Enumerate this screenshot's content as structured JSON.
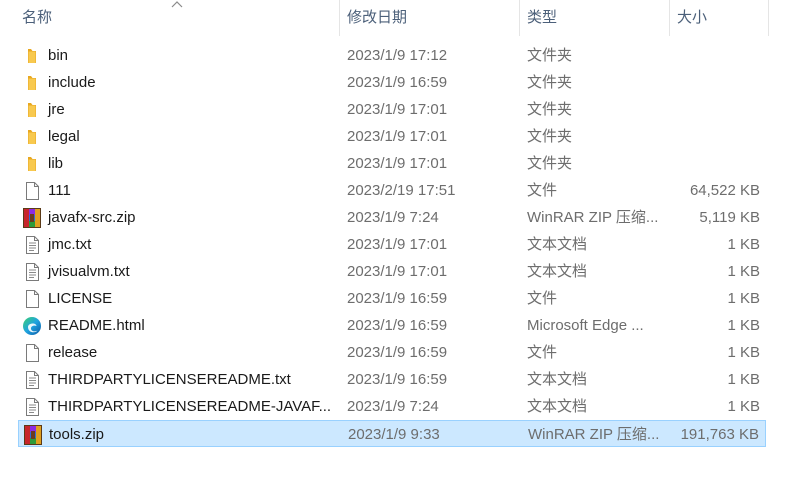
{
  "columns": {
    "name": "名称",
    "date": "修改日期",
    "type": "类型",
    "size": "大小"
  },
  "files": [
    {
      "name": "bin",
      "date": "2023/1/9 17:12",
      "type": "文件夹",
      "size": "",
      "icon": "folder-icon",
      "selected": false
    },
    {
      "name": "include",
      "date": "2023/1/9 16:59",
      "type": "文件夹",
      "size": "",
      "icon": "folder-icon",
      "selected": false
    },
    {
      "name": "jre",
      "date": "2023/1/9 17:01",
      "type": "文件夹",
      "size": "",
      "icon": "folder-icon",
      "selected": false
    },
    {
      "name": "legal",
      "date": "2023/1/9 17:01",
      "type": "文件夹",
      "size": "",
      "icon": "folder-icon",
      "selected": false
    },
    {
      "name": "lib",
      "date": "2023/1/9 17:01",
      "type": "文件夹",
      "size": "",
      "icon": "folder-icon",
      "selected": false
    },
    {
      "name": "111",
      "date": "2023/2/19 17:51",
      "type": "文件",
      "size": "64,522 KB",
      "icon": "file-icon",
      "selected": false
    },
    {
      "name": "javafx-src.zip",
      "date": "2023/1/9 7:24",
      "type": "WinRAR ZIP 压缩...",
      "size": "5,119 KB",
      "icon": "winrar-zip-icon",
      "selected": false
    },
    {
      "name": "jmc.txt",
      "date": "2023/1/9 17:01",
      "type": "文本文档",
      "size": "1 KB",
      "icon": "text-file-icon",
      "selected": false
    },
    {
      "name": "jvisualvm.txt",
      "date": "2023/1/9 17:01",
      "type": "文本文档",
      "size": "1 KB",
      "icon": "text-file-icon",
      "selected": false
    },
    {
      "name": "LICENSE",
      "date": "2023/1/9 16:59",
      "type": "文件",
      "size": "1 KB",
      "icon": "file-icon",
      "selected": false
    },
    {
      "name": "README.html",
      "date": "2023/1/9 16:59",
      "type": "Microsoft Edge ...",
      "size": "1 KB",
      "icon": "edge-icon",
      "selected": false
    },
    {
      "name": "release",
      "date": "2023/1/9 16:59",
      "type": "文件",
      "size": "1 KB",
      "icon": "file-icon",
      "selected": false
    },
    {
      "name": "THIRDPARTYLICENSEREADME.txt",
      "date": "2023/1/9 16:59",
      "type": "文本文档",
      "size": "1 KB",
      "icon": "text-file-icon",
      "selected": false
    },
    {
      "name": "THIRDPARTYLICENSEREADME-JAVAF...",
      "date": "2023/1/9 7:24",
      "type": "文本文档",
      "size": "1 KB",
      "icon": "text-file-icon",
      "selected": false
    },
    {
      "name": "tools.zip",
      "date": "2023/1/9 9:33",
      "type": "WinRAR ZIP 压缩...",
      "size": "191,763 KB",
      "icon": "winrar-zip-icon",
      "selected": true
    }
  ],
  "colors": {
    "header_text": "#4c607a",
    "selection_bg": "#cce8ff",
    "selection_border": "#99d1ff",
    "folder": "#f8c94f"
  }
}
